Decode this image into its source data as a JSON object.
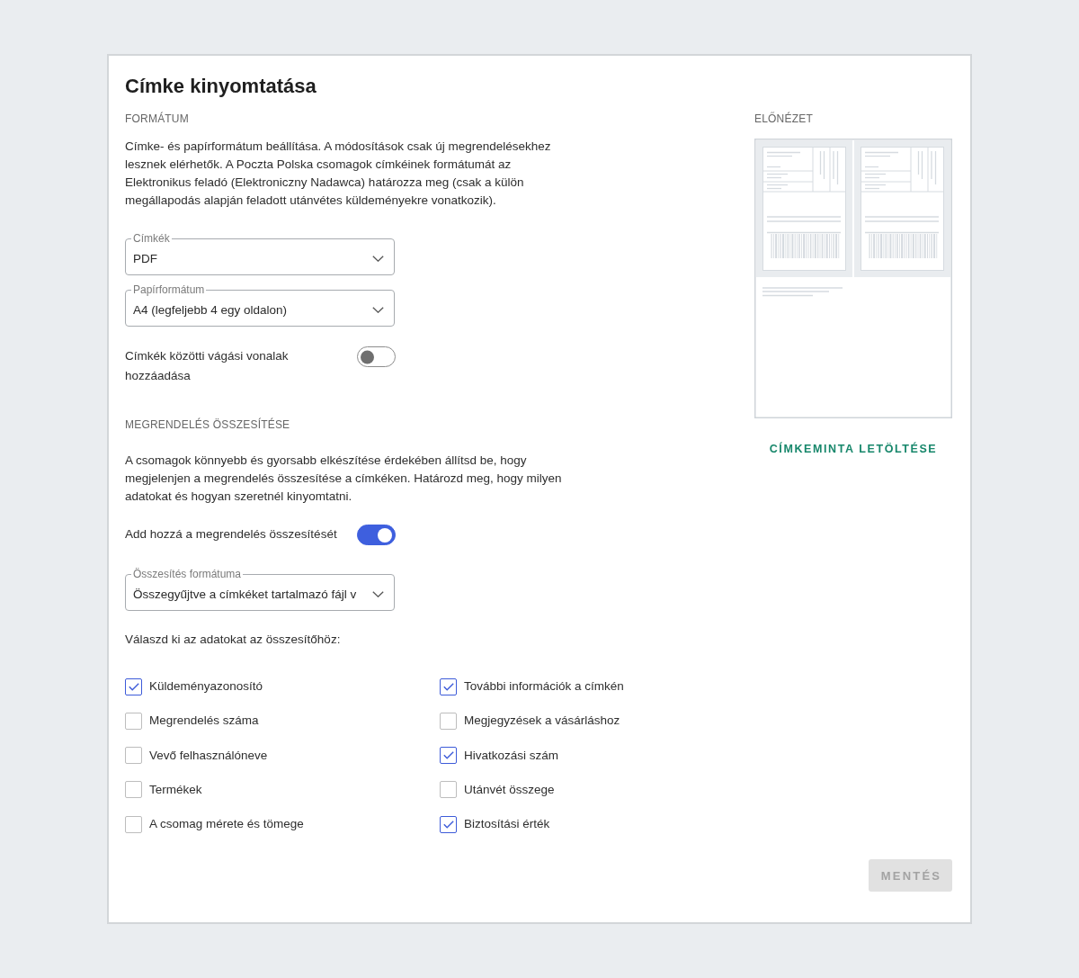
{
  "dialog": {
    "title": "Címke kinyomtatása"
  },
  "format_section": {
    "heading": "FORMÁTUM",
    "description": "Címke- és papírformátum beállítása. A módosítások csak új megrendelésekhez lesznek elérhetők. A Poczta Polska csomagok címkéinek formátumát az Elektronikus feladó (Elektroniczny Nadawca) határozza meg (csak a külön megállapodás alapján feladott utánvétes küldeményekre vonatkozik).",
    "selects": [
      {
        "label": "Címkék",
        "value": "PDF"
      },
      {
        "label": "Papírformátum",
        "value": "A4 (legfeljebb 4 egy oldalon)"
      }
    ],
    "toggle": {
      "label": "Címkék közötti vágási vonalak hozzáadása",
      "on": false
    }
  },
  "summary_section": {
    "heading": "MEGRENDELÉS ÖSSZESÍTÉSE",
    "description": "A csomagok könnyebb és gyorsabb elkészítése érdekében állítsd be, hogy megjelenjen a megrendelés összesítése a címkéken. Határozd meg, hogy milyen adatokat és hogyan szeretnél kinyomtatni.",
    "toggle": {
      "label": "Add hozzá a megrendelés összesítését",
      "on": true
    },
    "select": {
      "label": "Összesítés formátuma",
      "value": "Összegyűjtve a címkéket tartalmazó fájl v"
    },
    "options_prompt": "Válaszd ki az adatokat az összesítőhöz:",
    "options": [
      {
        "label": "Küldeményazonosító",
        "checked": true
      },
      {
        "label": "További információk a címkén",
        "checked": true
      },
      {
        "label": "Megrendelés száma",
        "checked": false
      },
      {
        "label": "Megjegyzések a vásárláshoz",
        "checked": false
      },
      {
        "label": "Vevő felhasználóneve",
        "checked": false
      },
      {
        "label": "Hivatkozási szám",
        "checked": true
      },
      {
        "label": "Termékek",
        "checked": false
      },
      {
        "label": "Utánvét összege",
        "checked": false
      },
      {
        "label": "A csomag mérete és tömege",
        "checked": false
      },
      {
        "label": "Biztosítási érték",
        "checked": true
      }
    ]
  },
  "preview": {
    "heading": "ELŐNÉZET",
    "download_link": "CÍMKEMINTA LETÖLTÉSE"
  },
  "save_button": {
    "label": "MENTÉS",
    "disabled": true
  }
}
